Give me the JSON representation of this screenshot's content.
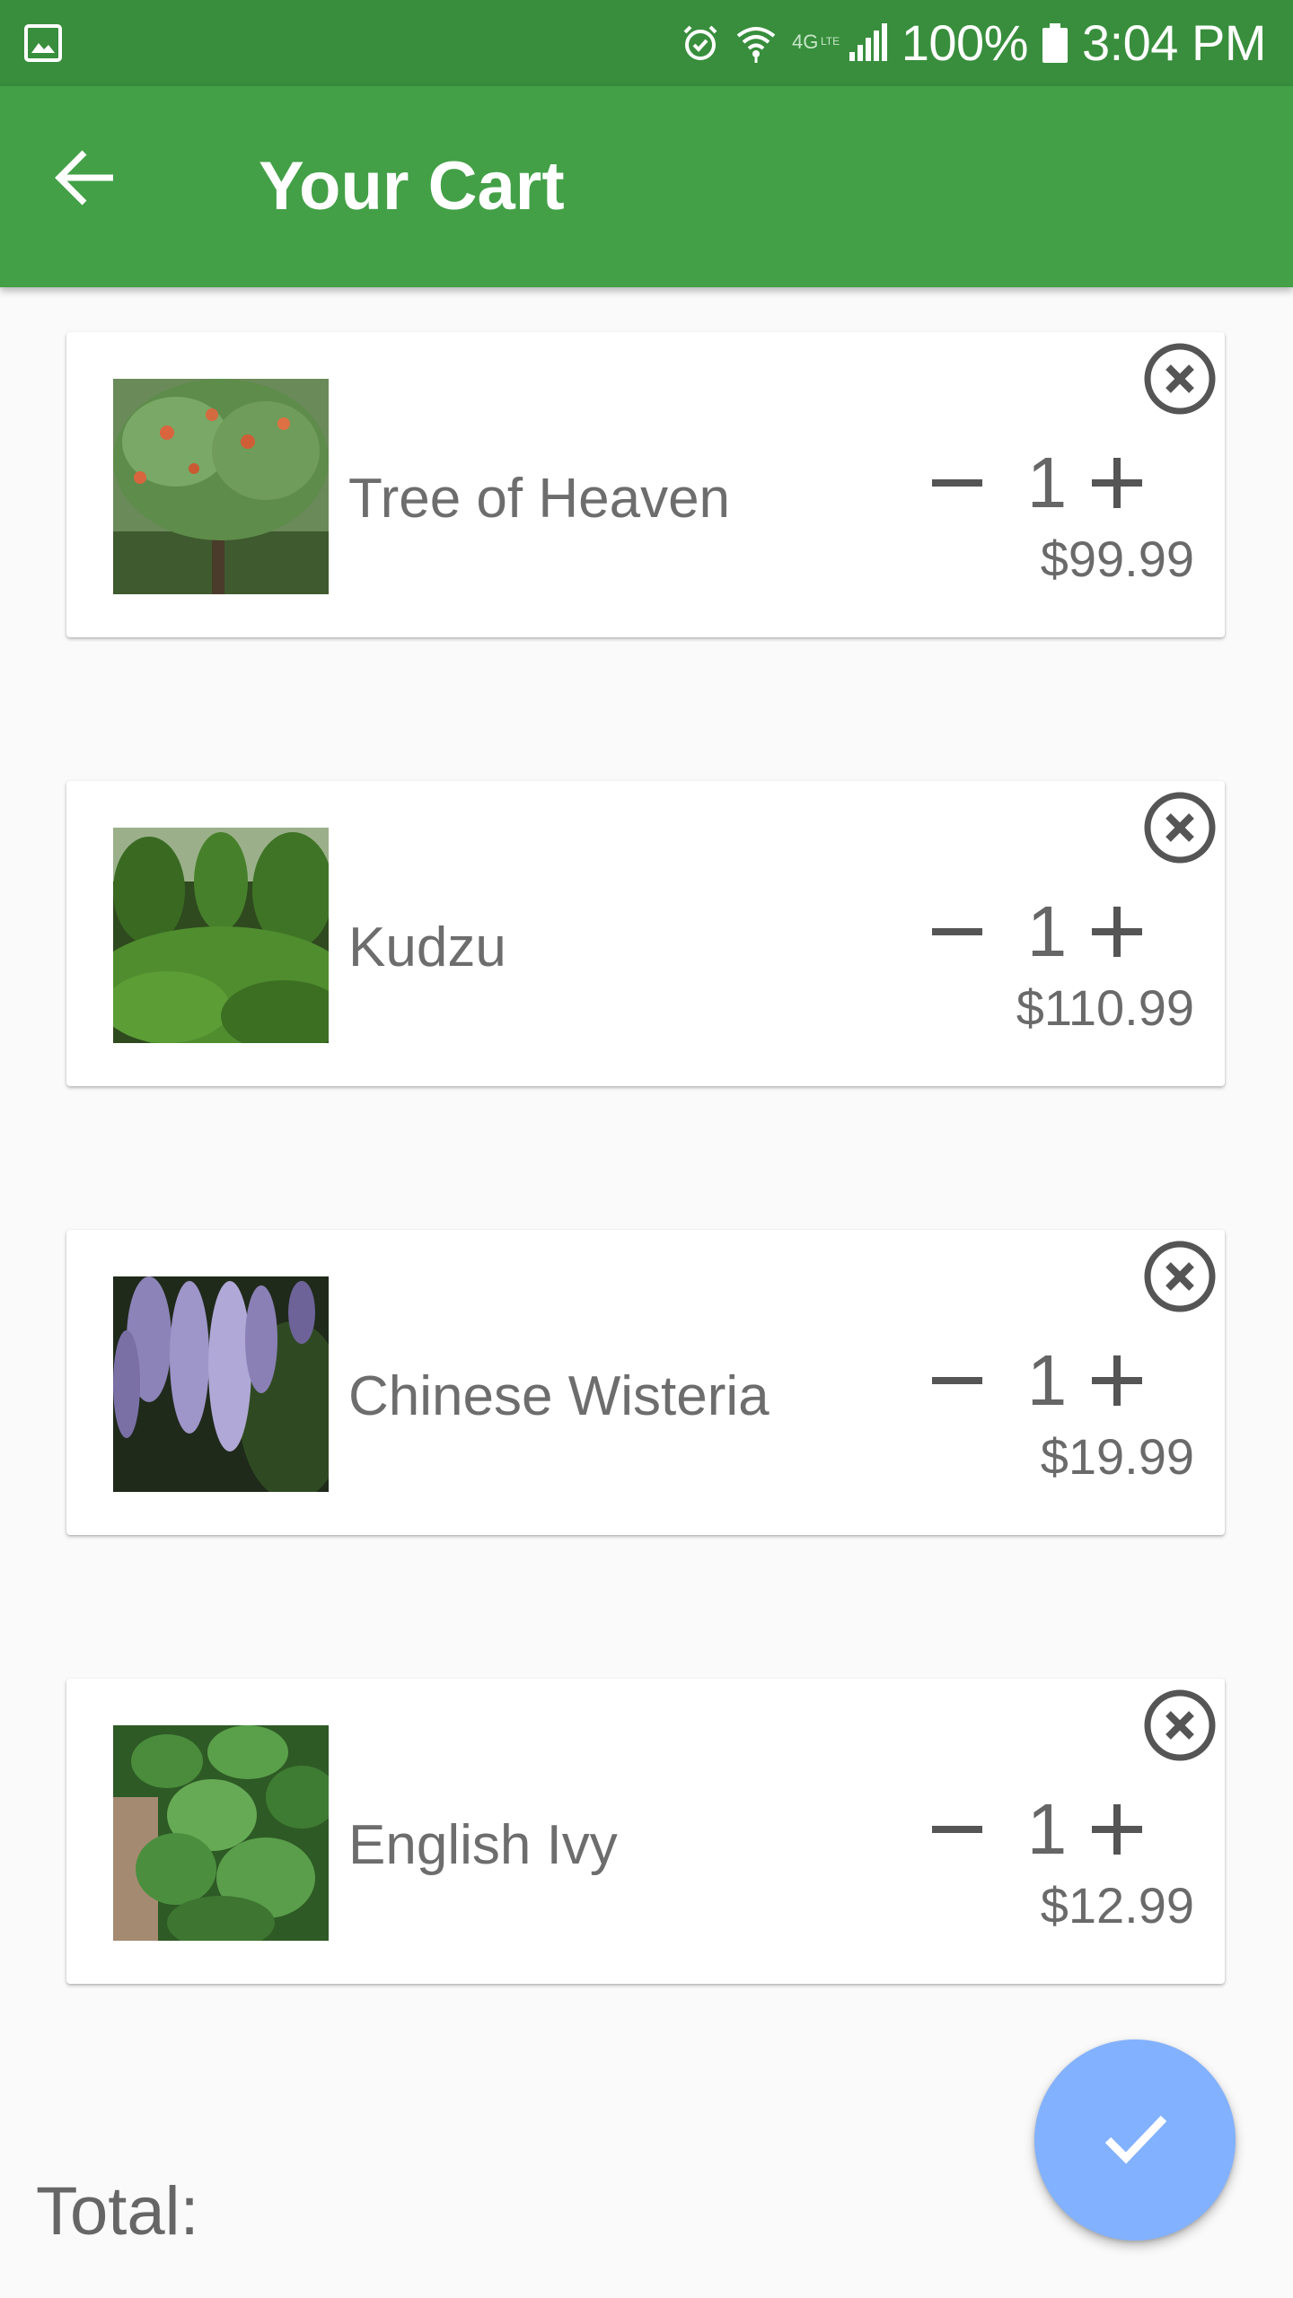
{
  "status_bar": {
    "left_icon": "gallery-icon",
    "icons": [
      "alarm-icon",
      "wifi-icon",
      "4g-lte-icon",
      "signal-icon"
    ],
    "battery_percent": "100%",
    "battery_icon": "battery-full-icon",
    "time": "3:04 PM"
  },
  "app_bar": {
    "back_icon": "arrow-back-icon",
    "title": "Your Cart",
    "color": "#43a047"
  },
  "cart": {
    "items": [
      {
        "name": "Tree of Heaven",
        "quantity": "1",
        "price": "$99.99",
        "image_icon": "tree-of-heaven-photo",
        "minus_icon": "minus-icon",
        "plus_icon": "plus-icon",
        "remove_icon": "remove-circle-icon"
      },
      {
        "name": "Kudzu",
        "quantity": "1",
        "price": "$110.99",
        "image_icon": "kudzu-photo",
        "minus_icon": "minus-icon",
        "plus_icon": "plus-icon",
        "remove_icon": "remove-circle-icon"
      },
      {
        "name": "Chinese Wisteria",
        "quantity": "1",
        "price": "$19.99",
        "image_icon": "chinese-wisteria-photo",
        "minus_icon": "minus-icon",
        "plus_icon": "plus-icon",
        "remove_icon": "remove-circle-icon"
      },
      {
        "name": "English Ivy",
        "quantity": "1",
        "price": "$12.99",
        "image_icon": "english-ivy-photo",
        "minus_icon": "minus-icon",
        "plus_icon": "plus-icon",
        "remove_icon": "remove-circle-icon"
      }
    ]
  },
  "total": {
    "label": "Total:"
  },
  "fab": {
    "icon": "check-icon",
    "color": "#82b1ff"
  }
}
